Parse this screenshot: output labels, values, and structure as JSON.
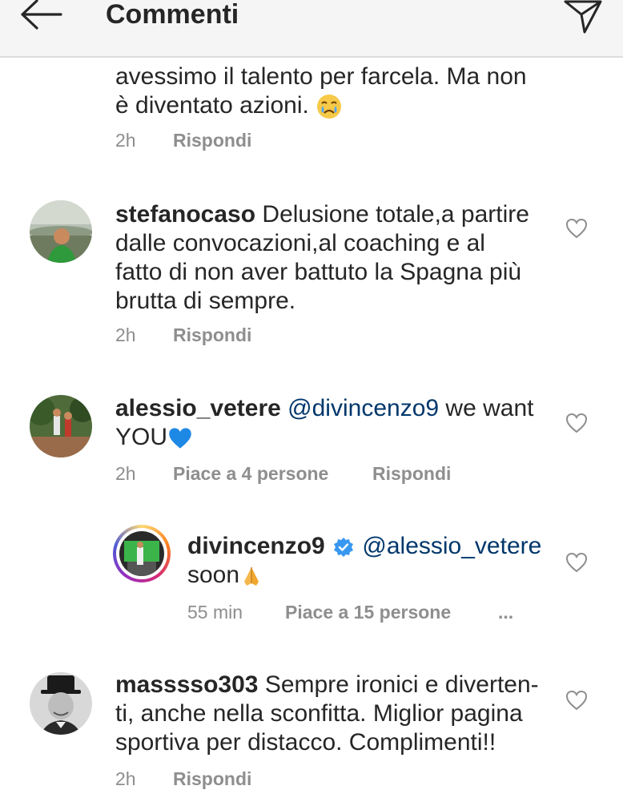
{
  "header": {
    "title": "Commenti",
    "back_icon": "arrow-left-icon",
    "send_icon": "paper-plane-icon"
  },
  "comments": [
    {
      "text_line1": "avessimo il talento per farcela. Ma non",
      "text_line2": "è diventato azioni.",
      "emoji": "crying-face",
      "time": "2h",
      "reply": "Rispondi"
    },
    {
      "username": "stefanocaso",
      "line1": "Delusione totale,a partire",
      "line2": "dalle convocazioni,al coaching e al",
      "line3": "fatto di non aver battuto la Spagna più",
      "line4": "brutta di sempre.",
      "time": "2h",
      "reply": "Rispondi"
    },
    {
      "username": "alessio_vetere",
      "mention": "@divincenzo9",
      "line1_rest": "we want",
      "line2": "YOU",
      "emoji": "blue-heart",
      "time": "2h",
      "likes": "Piace a 4 persone",
      "reply": "Rispondi"
    },
    {
      "username": "divincenzo9",
      "verified": true,
      "mention": "@alessio_vetere",
      "line2": "soon",
      "emoji": "folded-hands",
      "time": "55 min",
      "likes": "Piace a 15 persone",
      "more": "..."
    },
    {
      "username": "masssso303",
      "line1": "Sempre ironici e diverten-",
      "line2": "ti, anche nella sconfitta. Miglior pagina",
      "line3": "sportiva per distacco. Complimenti!!",
      "time": "2h",
      "reply": "Rispondi"
    }
  ],
  "colors": {
    "text": "#262626",
    "secondary": "#8e8e8e",
    "mention": "#00376b",
    "verified": "#3897f0",
    "heart_outline": "#8e8e8e"
  }
}
